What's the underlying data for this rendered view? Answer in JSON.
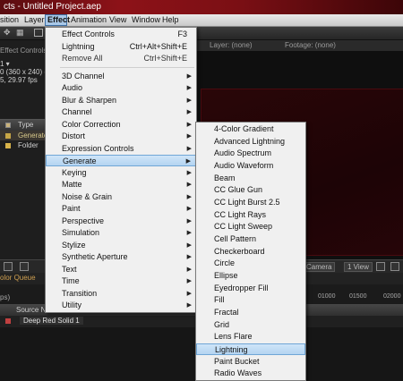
{
  "window": {
    "title": "cts - Untitled Project.aep"
  },
  "menubar": {
    "items": [
      "sition",
      "Layer",
      "Effect",
      "Animation",
      "View",
      "Window",
      "Help"
    ]
  },
  "left_panel": {
    "tab_label": "Effect Controls",
    "info_line1": "1 ▾",
    "info_line2": "0 (360 x 240) (",
    "info_line3": "5, 29.97 fps",
    "type_header": "Type",
    "rows": [
      {
        "name": "Generate",
        "swatch": "#c7a646"
      },
      {
        "name": "Folder",
        "swatch": "#d8b34a"
      }
    ]
  },
  "comp_panel": {
    "layer_tab": "Layer: (none)",
    "footage_tab": "Footage: (none)"
  },
  "bottom": {
    "camera_label": "Camera",
    "view_label": "1 View",
    "timeline_tab": "olor Queue",
    "ruler_left": "ps)",
    "ruler_marks": [
      "01000",
      "01500",
      "02000"
    ],
    "source_name_header": "Source Na...",
    "layer_name": "Deep Red Solid 1"
  },
  "effect_menu": {
    "items": [
      {
        "label": "Effect Controls",
        "shortcut": "F3"
      },
      {
        "label": "Lightning",
        "shortcut": "Ctrl+Alt+Shift+E"
      },
      {
        "label": "Remove All",
        "shortcut": "Ctrl+Shift+E"
      },
      {
        "label": "3D Channel"
      },
      {
        "label": "Audio"
      },
      {
        "label": "Blur & Sharpen"
      },
      {
        "label": "Channel"
      },
      {
        "label": "Color Correction"
      },
      {
        "label": "Distort"
      },
      {
        "label": "Expression Controls"
      },
      {
        "label": "Generate"
      },
      {
        "label": "Keying"
      },
      {
        "label": "Matte"
      },
      {
        "label": "Noise & Grain"
      },
      {
        "label": "Paint"
      },
      {
        "label": "Perspective"
      },
      {
        "label": "Simulation"
      },
      {
        "label": "Stylize"
      },
      {
        "label": "Synthetic Aperture"
      },
      {
        "label": "Text"
      },
      {
        "label": "Time"
      },
      {
        "label": "Transition"
      },
      {
        "label": "Utility"
      }
    ]
  },
  "generate_submenu": {
    "items": [
      "4-Color Gradient",
      "Advanced Lightning",
      "Audio Spectrum",
      "Audio Waveform",
      "Beam",
      "CC Glue Gun",
      "CC Light Burst 2.5",
      "CC Light Rays",
      "CC Light Sweep",
      "Cell Pattern",
      "Checkerboard",
      "Circle",
      "Ellipse",
      "Eyedropper Fill",
      "Fill",
      "Fractal",
      "Grid",
      "Lens Flare",
      "Lightning",
      "Paint Bucket",
      "Radio Waves"
    ]
  },
  "colors": {
    "title_red": "#8d1218",
    "menu_highlight": "#b4d4f1",
    "comp_solid": "#220507"
  }
}
